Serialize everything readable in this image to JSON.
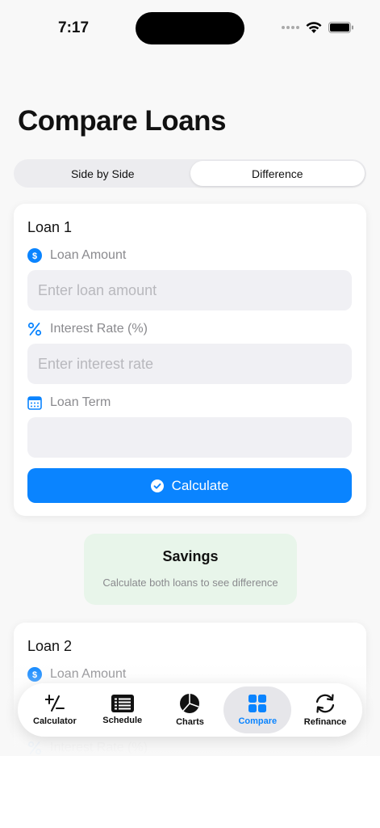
{
  "status": {
    "time": "7:17"
  },
  "page": {
    "title": "Compare Loans"
  },
  "segments": [
    "Side by Side",
    "Difference"
  ],
  "loan1": {
    "title": "Loan 1",
    "amount_label": "Loan Amount",
    "amount_placeholder": "Enter loan amount",
    "rate_label": "Interest Rate (%)",
    "rate_placeholder": "Enter interest rate",
    "term_label": "Loan Term",
    "calculate_label": "Calculate"
  },
  "savings": {
    "title": "Savings",
    "subtitle": "Calculate both loans to see difference"
  },
  "loan2": {
    "title": "Loan 2",
    "amount_label": "Loan Amount",
    "rate_label": "Interest Rate (%)"
  },
  "tabs": [
    "Calculator",
    "Schedule",
    "Charts",
    "Compare",
    "Refinance"
  ],
  "colors": {
    "accent": "#0a84ff",
    "savings_bg": "#e8f5ea"
  },
  "icons": {
    "amount": "dollar-circle-icon",
    "rate": "percent-icon",
    "term": "calendar-icon",
    "calculate": "checkmark-circle-icon"
  }
}
